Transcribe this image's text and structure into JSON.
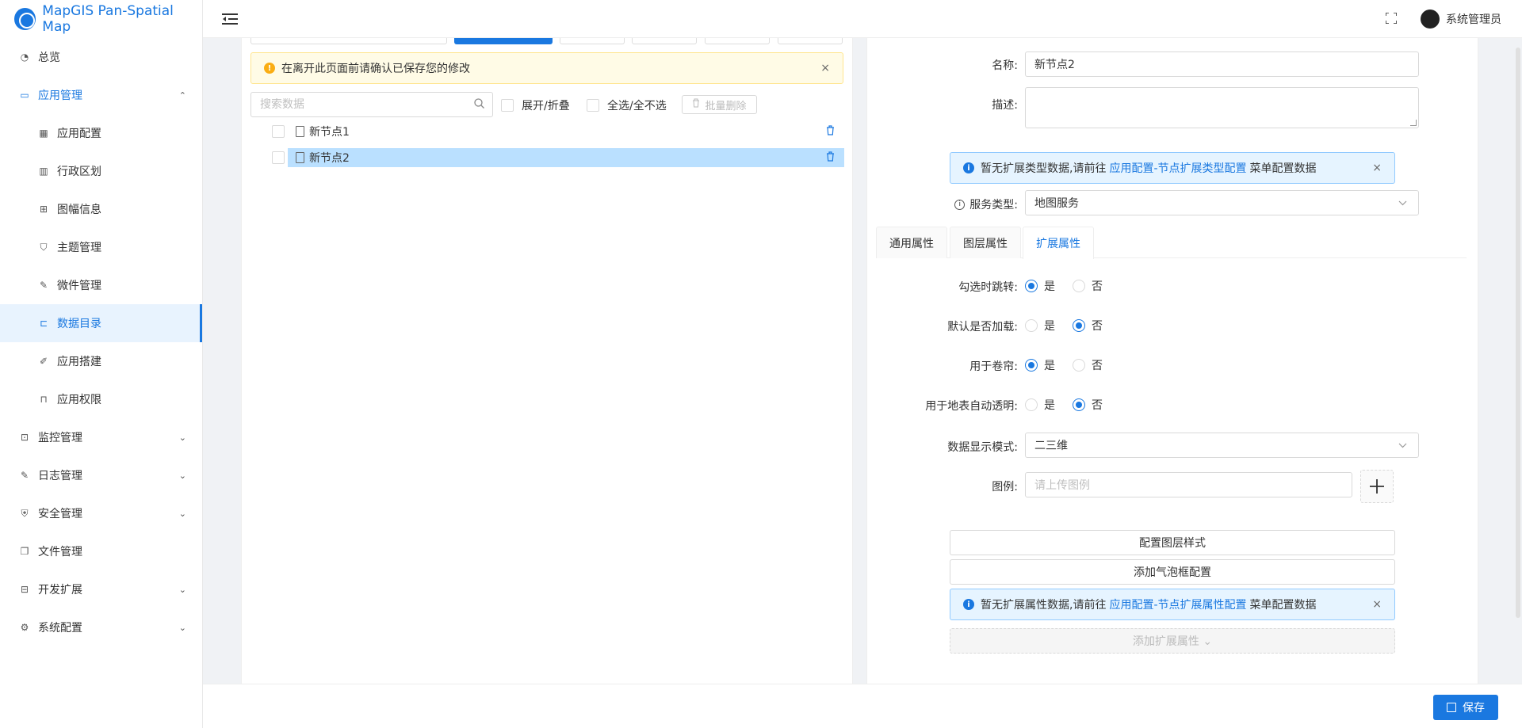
{
  "app": {
    "title": "MapGIS Pan-Spatial Map"
  },
  "header": {
    "username": "系统管理员"
  },
  "sidebar": {
    "items": [
      {
        "label": "总览",
        "icon": "dashboard-icon",
        "glyph": "◔"
      },
      {
        "label": "应用管理",
        "icon": "monitor-icon",
        "glyph": "▭",
        "arrow": "⌃"
      },
      {
        "label": "应用配置",
        "icon": "layout-icon",
        "glyph": "▦"
      },
      {
        "label": "行政区划",
        "icon": "map-icon",
        "glyph": "▥"
      },
      {
        "label": "图幅信息",
        "icon": "grid-icon",
        "glyph": "⊞"
      },
      {
        "label": "主题管理",
        "icon": "shirt-icon",
        "glyph": "⛉"
      },
      {
        "label": "微件管理",
        "icon": "widget-icon",
        "glyph": "✎"
      },
      {
        "label": "数据目录",
        "icon": "tree-icon",
        "glyph": "⊏"
      },
      {
        "label": "应用搭建",
        "icon": "edit-icon",
        "glyph": "✐"
      },
      {
        "label": "应用权限",
        "icon": "lock-icon",
        "glyph": "⊓"
      },
      {
        "label": "监控管理",
        "icon": "monitor-chart-icon",
        "glyph": "⊡",
        "arrow": "⌄"
      },
      {
        "label": "日志管理",
        "icon": "log-icon",
        "glyph": "✎",
        "arrow": "⌄"
      },
      {
        "label": "安全管理",
        "icon": "shield-icon",
        "glyph": "⛨",
        "arrow": "⌄"
      },
      {
        "label": "文件管理",
        "icon": "file-icon",
        "glyph": "❐"
      },
      {
        "label": "开发扩展",
        "icon": "toolbox-icon",
        "glyph": "⊟",
        "arrow": "⌄"
      },
      {
        "label": "系统配置",
        "icon": "gear-icon",
        "glyph": "⚙",
        "arrow": "⌄"
      }
    ]
  },
  "left": {
    "alert": "在离开此页面前请确认已保存您的修改",
    "alert_close": "×",
    "warn_glyph": "!",
    "search_placeholder": "搜索数据",
    "expand_label": "展开/折叠",
    "select_all_label": "全选/全不选",
    "batch_delete_label": "批量删除",
    "tree": [
      {
        "label": "新节点1",
        "selected": false
      },
      {
        "label": "新节点2",
        "selected": true
      }
    ]
  },
  "right": {
    "name_label": "名称:",
    "name_value": "新节点2",
    "desc_label": "描述:",
    "info1": {
      "prefix": "暂无扩展类型数据,请前往",
      "link": "应用配置-节点扩展类型配置",
      "suffix": "菜单配置数据"
    },
    "service_label": "服务类型:",
    "service_value": "地图服务",
    "tabs": [
      "通用属性",
      "图层属性",
      "扩展属性"
    ],
    "active_tab": 2,
    "radios": [
      {
        "label": "勾选时跳转:",
        "yes": "是",
        "no": "否",
        "value": "是"
      },
      {
        "label": "默认是否加载:",
        "yes": "是",
        "no": "否",
        "value": "否"
      },
      {
        "label": "用于卷帘:",
        "yes": "是",
        "no": "否",
        "value": "是"
      },
      {
        "label": "用于地表自动透明:",
        "yes": "是",
        "no": "否",
        "value": "否"
      }
    ],
    "display_mode_label": "数据显示模式:",
    "display_mode_value": "二三维",
    "legend_label": "图例:",
    "legend_placeholder": "请上传图例",
    "config_style_btn": "配置图层样式",
    "add_bubble_btn": "添加气泡框配置",
    "info2": {
      "prefix": "暂无扩展属性数据,请前往",
      "link": "应用配置-节点扩展属性配置",
      "suffix": "菜单配置数据"
    },
    "add_ext_btn": "添加扩展属性 ⌄",
    "info_close": "×",
    "info_glyph": "i"
  },
  "footer": {
    "save_label": "保存"
  },
  "colors": {
    "primary": "#1a78e0",
    "warn": "#faad14",
    "selected_bg": "#bae0ff"
  }
}
